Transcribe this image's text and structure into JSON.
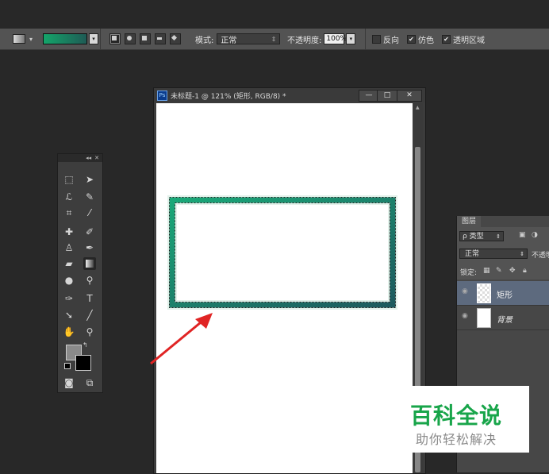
{
  "options_bar": {
    "mode_label": "模式:",
    "mode_value": "正常",
    "opacity_label": "不透明度:",
    "opacity_value": "100%",
    "reverse_label": "反向",
    "dither_label": "仿色",
    "transparency_label": "透明区域",
    "gradient_colors": [
      "#14a56a",
      "#1f5b55"
    ]
  },
  "document": {
    "title": "未标题-1 @ 121% (矩形, RGB/8) *",
    "badge": "Ps",
    "buttons": {
      "minimize": "—",
      "maximize": "□",
      "close": "✕"
    }
  },
  "layers_panel": {
    "tab": "图层",
    "filter_label": "ρ 类型",
    "blend_mode": "正常",
    "opacity_label": "不透明",
    "lock_label": "锁定:",
    "layers": [
      {
        "name": "矩形",
        "selected": true
      },
      {
        "name": "背景",
        "selected": false
      }
    ]
  },
  "watermark": {
    "title": "百科全说",
    "subtitle": "助你轻松解决",
    "color": "#18a54a"
  }
}
